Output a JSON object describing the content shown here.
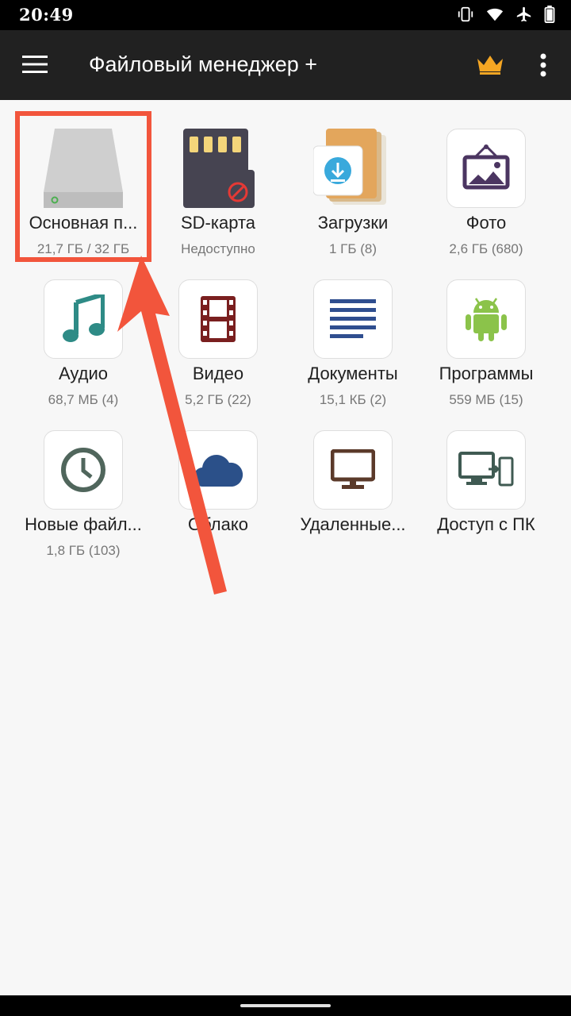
{
  "status": {
    "time": "20:49"
  },
  "appbar": {
    "title": "Файловый менеджер +"
  },
  "tiles": [
    {
      "label": "Основная п...",
      "sub": "21,7 ГБ / 32 ГБ"
    },
    {
      "label": "SD-карта",
      "sub": "Недоступно"
    },
    {
      "label": "Загрузки",
      "sub": "1 ГБ (8)"
    },
    {
      "label": "Фото",
      "sub": "2,6 ГБ (680)"
    },
    {
      "label": "Аудио",
      "sub": "68,7 МБ (4)"
    },
    {
      "label": "Видео",
      "sub": "5,2 ГБ (22)"
    },
    {
      "label": "Документы",
      "sub": "15,1 КБ (2)"
    },
    {
      "label": "Программы",
      "sub": "559 МБ (15)"
    },
    {
      "label": "Новые файл...",
      "sub": "1,8 ГБ (103)"
    },
    {
      "label": "Облако",
      "sub": ""
    },
    {
      "label": "Удаленные...",
      "sub": ""
    },
    {
      "label": "Доступ с ПК",
      "sub": ""
    }
  ],
  "colors": {
    "highlight": "#f2553c",
    "crown": "#f5a623",
    "appbar": "#212121"
  }
}
